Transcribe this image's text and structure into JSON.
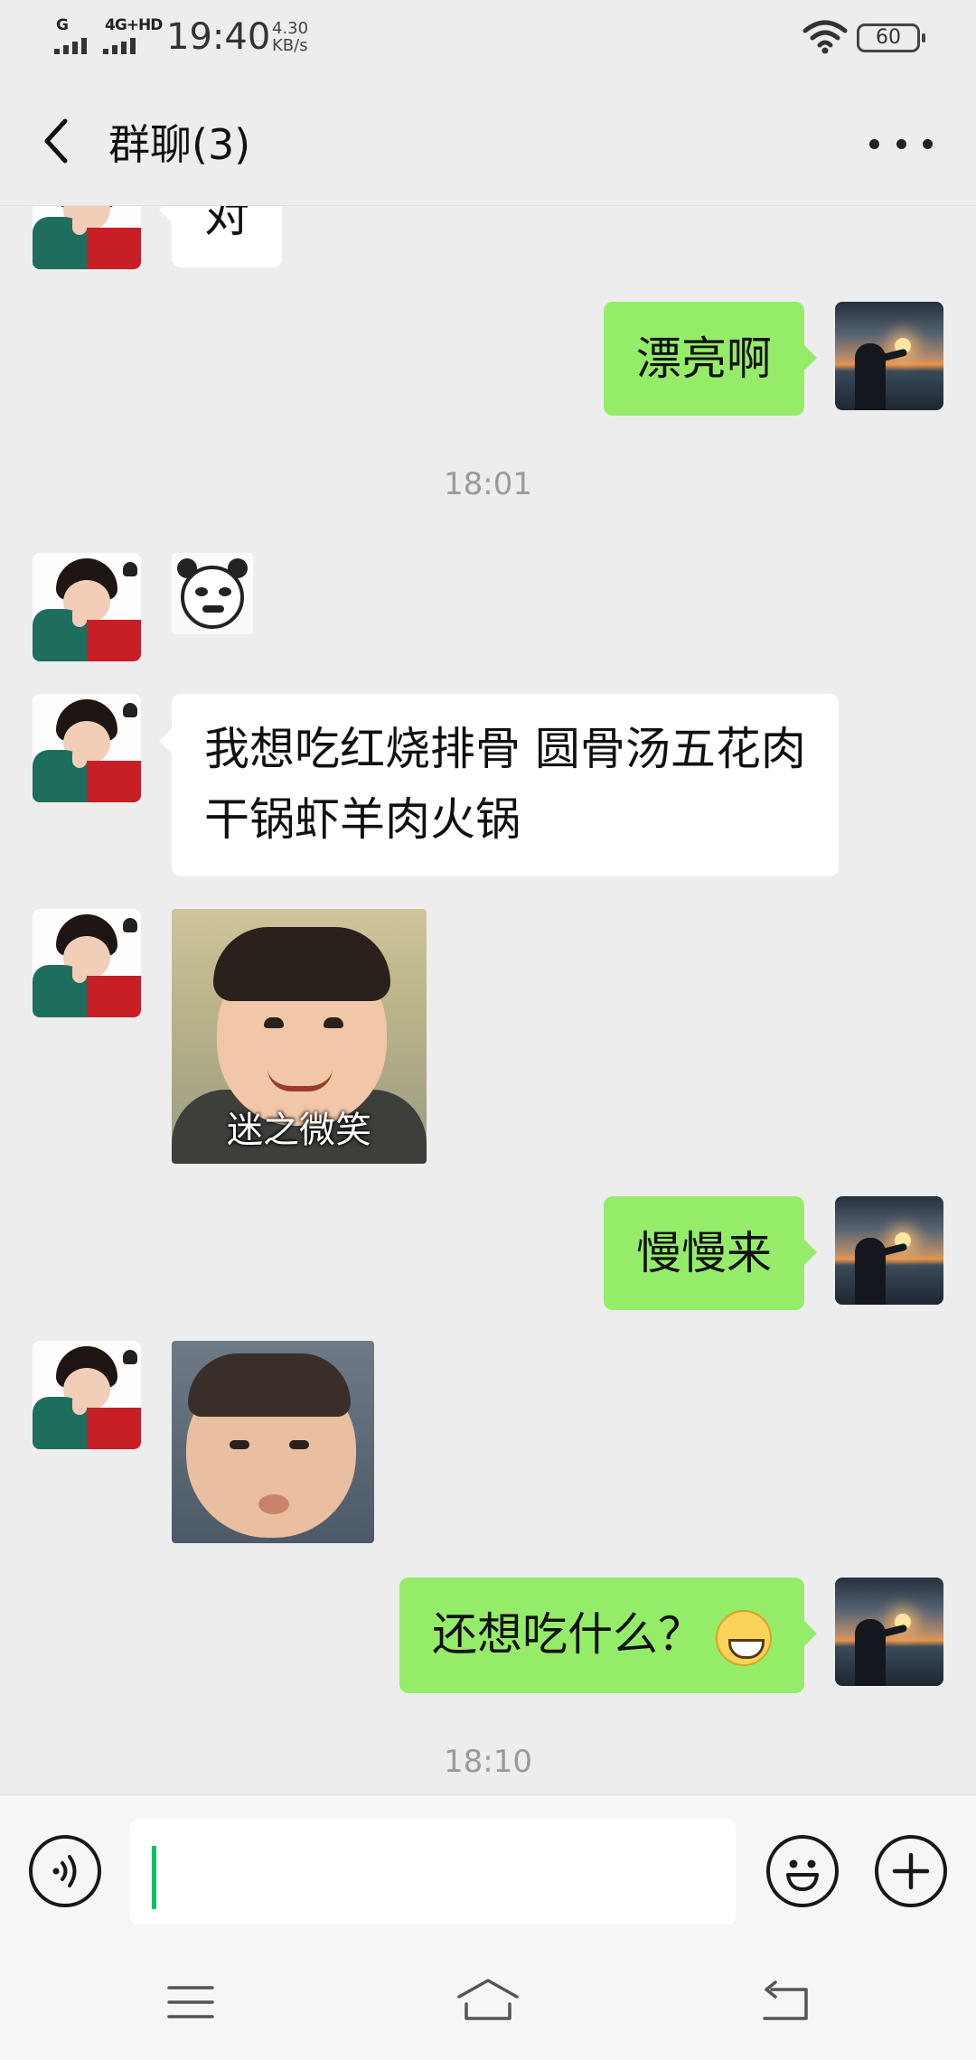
{
  "status_bar": {
    "signal_1": "G",
    "signal_2": "4G+HD",
    "time": "19:40",
    "speed_value": "4.30",
    "speed_unit": "KB/s",
    "battery": "60"
  },
  "header": {
    "back_icon": "chevron-left-icon",
    "title": "群聊(3)",
    "more_icon": "more-dots-icon"
  },
  "messages": {
    "partial_top": "对",
    "m1": "漂亮啊",
    "ts1": "18:01",
    "m2": "我想吃红烧排骨 圆骨汤五花肉干锅虾羊肉火锅",
    "sticker_caption": "迷之微笑",
    "m3": "慢慢来",
    "m4": "还想吃什么？",
    "m4_emoji": "grinning-face-emoji",
    "ts2": "18:10"
  },
  "input_bar": {
    "voice_icon": "voice-icon",
    "emoji_icon": "emoji-icon",
    "plus_icon": "plus-icon",
    "text_value": ""
  },
  "nav_bar": {
    "menu_icon": "menu-icon",
    "home_icon": "home-icon",
    "back_icon": "back-icon"
  }
}
